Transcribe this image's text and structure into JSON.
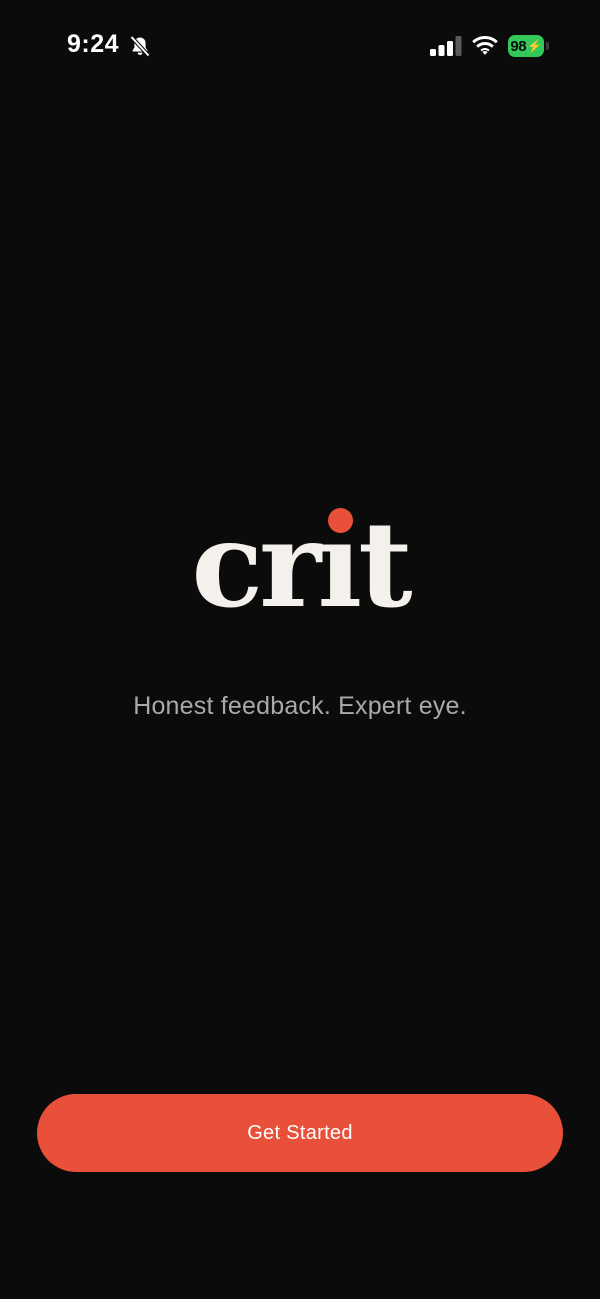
{
  "status_bar": {
    "time": "9:24",
    "battery_level": "98",
    "icons": [
      "bell-slash-icon",
      "cellular-signal-icon",
      "wifi-icon",
      "battery-icon",
      "bolt-icon"
    ],
    "battery_color": "#34c759"
  },
  "brand": {
    "logo_text": "crit",
    "accent_color": "#e8503a"
  },
  "tagline": "Honest feedback. Expert eye.",
  "actions": {
    "get_started_label": "Get Started"
  },
  "colors": {
    "background": "#0b0b0b",
    "logo_text": "#f4f1ec",
    "tagline": "#a9a9a9",
    "button": "#e8503a"
  }
}
